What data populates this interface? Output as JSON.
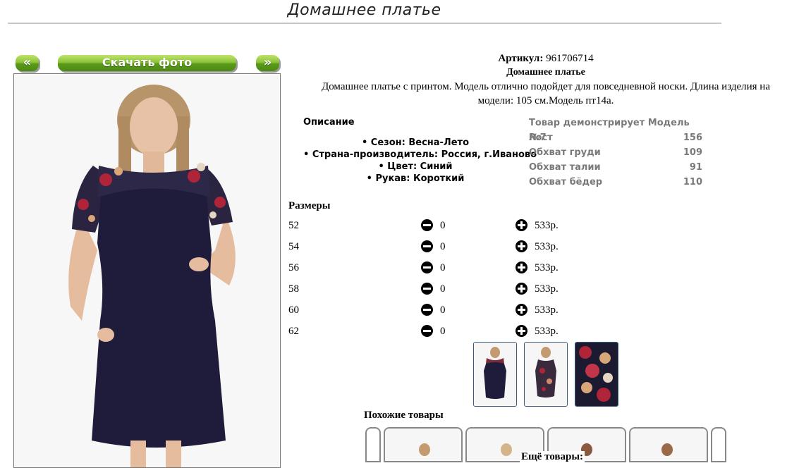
{
  "page": {
    "title": "Домашнее платье"
  },
  "gallery": {
    "prev_label": "«",
    "next_label": "»",
    "download_label": "Скачать фото"
  },
  "product": {
    "article_label": "Артикул:",
    "article_value": "961706714",
    "name": "Домашнее платье",
    "description": "Домашнее платье с принтом. Модель отлично подойдет для повседневной носки. Длина изделия на модели: 105 см.Модель пт14а."
  },
  "specs": {
    "title": "Описание",
    "items": [
      "• Сезон: Весна-Лето",
      "• Страна-производитель: Россия, г.Иваново",
      "• Цвет: Синий",
      "• Рукав: Короткий"
    ]
  },
  "model": {
    "header": "Товар демонстрирует Модель №7",
    "rows": [
      {
        "label": "Рост",
        "value": "156"
      },
      {
        "label": "Обхват груди",
        "value": "109"
      },
      {
        "label": "Обхват талии",
        "value": "91"
      },
      {
        "label": "Обхват бёдер",
        "value": "110"
      }
    ]
  },
  "sizes": {
    "title": "Размеры",
    "rows": [
      {
        "size": "52",
        "qty": "0",
        "price": "533р."
      },
      {
        "size": "54",
        "qty": "0",
        "price": "533р."
      },
      {
        "size": "56",
        "qty": "0",
        "price": "533р."
      },
      {
        "size": "58",
        "qty": "0",
        "price": "533р."
      },
      {
        "size": "60",
        "qty": "0",
        "price": "533р."
      },
      {
        "size": "62",
        "qty": "0",
        "price": "533р."
      }
    ]
  },
  "similar": {
    "title": "Похожие товары"
  },
  "more": {
    "title": "Ещё товары:"
  },
  "colors": {
    "dress": "#1e1c3a",
    "button_green": "#6aac22",
    "print_red": "#b0243a"
  }
}
